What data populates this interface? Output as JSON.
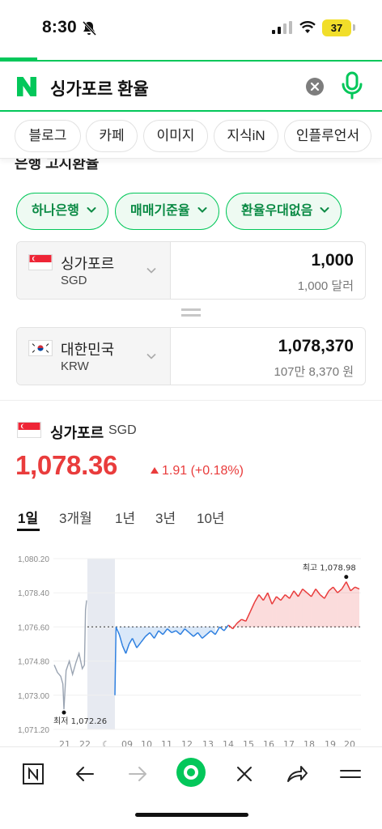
{
  "status_bar": {
    "time": "8:30",
    "battery_level": "37",
    "battery_color": "#f1de2a"
  },
  "search": {
    "query": "싱가포르 환율",
    "accent_color": "#03c75a"
  },
  "tabs": [
    {
      "label": "블로그"
    },
    {
      "label": "카페"
    },
    {
      "label": "이미지"
    },
    {
      "label": "지식iN"
    },
    {
      "label": "인플루언서"
    }
  ],
  "section_title_partial": "은행 고시환율",
  "dropdowns": {
    "bank": "하나은행",
    "rate_type": "매매기준율",
    "discount": "환율우대없음"
  },
  "converter": {
    "from": {
      "country": "싱가포르",
      "code": "SGD",
      "amount": "1,000",
      "amount_text": "1,000 달러"
    },
    "to": {
      "country": "대한민국",
      "code": "KRW",
      "amount": "1,078,370",
      "amount_text": "107만 8,370 원"
    }
  },
  "rate": {
    "country": "싱가포르",
    "code": "SGD",
    "value": "1,078.36",
    "change": "1.91 (+0.18%)",
    "up_color": "#e93c3c",
    "down_color": "#2f80e0"
  },
  "periods": [
    {
      "label": "1일",
      "active": true
    },
    {
      "label": "3개월",
      "active": false
    },
    {
      "label": "1년",
      "active": false
    },
    {
      "label": "3년",
      "active": false
    },
    {
      "label": "10년",
      "active": false
    }
  ],
  "chart_data": {
    "type": "line",
    "title": "",
    "xlabel": "",
    "ylabel": "",
    "y_ticks": [
      "1,080.20",
      "1,078.40",
      "1,076.60",
      "1,074.80",
      "1,073.00",
      "1,071.20"
    ],
    "y_tick_values": [
      1080.2,
      1078.4,
      1076.6,
      1074.8,
      1073.0,
      1071.2
    ],
    "ylim": [
      1071.2,
      1080.2
    ],
    "x_ticks": [
      "21",
      "22",
      "☾",
      "09",
      "10",
      "11",
      "12",
      "13",
      "14",
      "15",
      "16",
      "17",
      "18",
      "19",
      "20"
    ],
    "baseline": 1076.6,
    "max_label": "최고 1,078.98",
    "max_value": 1078.98,
    "min_label": "최저 1,072.26",
    "min_value": 1072.26,
    "grid": true,
    "series": [
      {
        "segment": "previous-day",
        "color": "#9aa4b2",
        "points": [
          [
            20.6,
            1074.6
          ],
          [
            20.75,
            1074.2
          ],
          [
            20.9,
            1074.0
          ],
          [
            21.0,
            1073.6
          ],
          [
            21.05,
            1072.26
          ],
          [
            21.15,
            1074.3
          ],
          [
            21.3,
            1074.8
          ],
          [
            21.45,
            1074.1
          ],
          [
            21.6,
            1074.7
          ],
          [
            21.75,
            1075.2
          ],
          [
            21.9,
            1074.4
          ],
          [
            22.0,
            1074.6
          ],
          [
            22.05,
            1077.5
          ],
          [
            22.1,
            1078.0
          ]
        ]
      },
      {
        "segment": "today",
        "points": [
          [
            9.0,
            1073.0
          ],
          [
            9.05,
            1076.6
          ],
          [
            9.2,
            1076.2
          ],
          [
            9.35,
            1075.6
          ],
          [
            9.5,
            1075.2
          ],
          [
            9.65,
            1075.7
          ],
          [
            9.8,
            1076.0
          ],
          [
            10.0,
            1075.5
          ],
          [
            10.2,
            1075.8
          ],
          [
            10.4,
            1076.1
          ],
          [
            10.6,
            1076.3
          ],
          [
            10.8,
            1076.0
          ],
          [
            11.0,
            1076.4
          ],
          [
            11.2,
            1076.2
          ],
          [
            11.4,
            1076.5
          ],
          [
            11.6,
            1076.3
          ],
          [
            11.8,
            1076.4
          ],
          [
            12.0,
            1076.2
          ],
          [
            12.2,
            1076.5
          ],
          [
            12.4,
            1076.3
          ],
          [
            12.6,
            1076.1
          ],
          [
            12.8,
            1076.3
          ],
          [
            13.0,
            1076.0
          ],
          [
            13.2,
            1076.2
          ],
          [
            13.4,
            1076.4
          ],
          [
            13.6,
            1076.2
          ],
          [
            13.8,
            1076.6
          ],
          [
            14.0,
            1076.4
          ],
          [
            14.2,
            1076.7
          ],
          [
            14.4,
            1076.5
          ],
          [
            14.6,
            1076.8
          ],
          [
            14.8,
            1077.0
          ],
          [
            15.0,
            1076.9
          ],
          [
            15.2,
            1077.4
          ],
          [
            15.4,
            1077.9
          ],
          [
            15.6,
            1078.3
          ],
          [
            15.8,
            1078.0
          ],
          [
            16.0,
            1078.4
          ],
          [
            16.2,
            1077.8
          ],
          [
            16.4,
            1078.2
          ],
          [
            16.6,
            1078.0
          ],
          [
            16.8,
            1078.3
          ],
          [
            17.0,
            1078.1
          ],
          [
            17.2,
            1078.5
          ],
          [
            17.4,
            1078.2
          ],
          [
            17.6,
            1078.6
          ],
          [
            17.8,
            1078.4
          ],
          [
            18.0,
            1078.2
          ],
          [
            18.2,
            1078.6
          ],
          [
            18.4,
            1078.3
          ],
          [
            18.6,
            1078.1
          ],
          [
            18.8,
            1078.5
          ],
          [
            19.0,
            1078.7
          ],
          [
            19.2,
            1078.4
          ],
          [
            19.4,
            1078.6
          ],
          [
            19.6,
            1078.98
          ],
          [
            19.8,
            1078.5
          ],
          [
            20.0,
            1078.7
          ],
          [
            20.2,
            1078.6
          ]
        ]
      }
    ]
  }
}
